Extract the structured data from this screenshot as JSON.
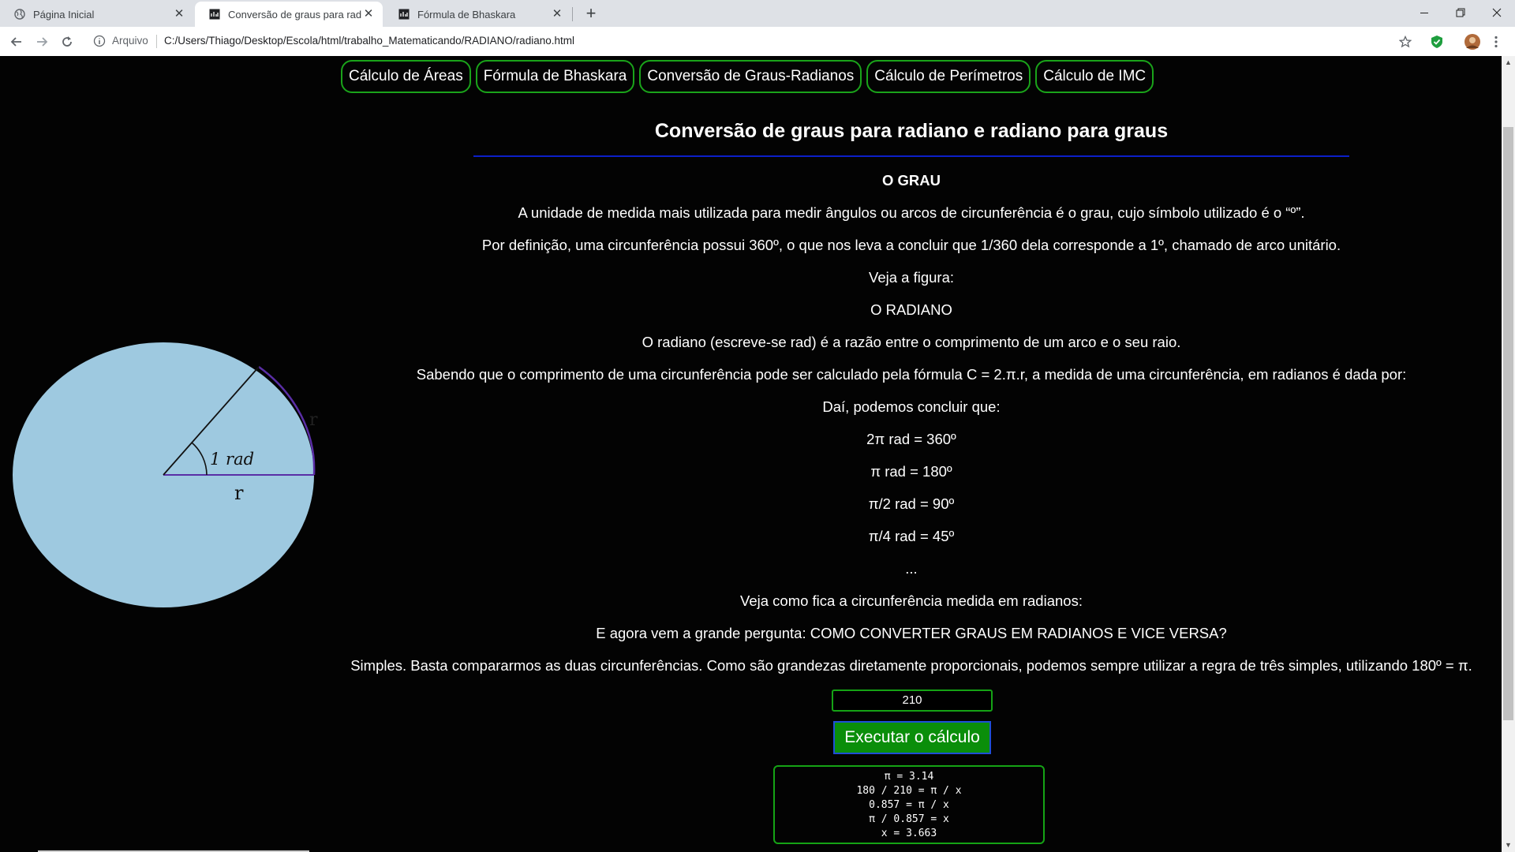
{
  "browser": {
    "tabs": [
      {
        "title": "Página Inicial"
      },
      {
        "title": "Conversão de graus para radiano"
      },
      {
        "title": "Fórmula de Bhaskara"
      }
    ],
    "address": {
      "scheme": "Arquivo",
      "url": "C:/Users/Thiago/Desktop/Escola/html/trabalho_Matematicando/RADIANO/radiano.html"
    }
  },
  "nav": {
    "items": [
      {
        "label": "Cálculo de Áreas"
      },
      {
        "label": "Fórmula de Bhaskara"
      },
      {
        "label": "Conversão de Graus-Radianos"
      },
      {
        "label": "Cálculo de Perímetros"
      },
      {
        "label": "Cálculo de IMC"
      }
    ]
  },
  "page": {
    "title": "Conversão de graus para radiano e radiano para graus",
    "section_title": "O GRAU",
    "p1": "A unidade de medida mais utilizada para medir ângulos ou arcos de circunferência é o grau, cujo símbolo utilizado é o “º”.",
    "p2": "Por definição, uma circunferência possui 360º, o que nos leva a concluir que 1/360 dela corresponde a 1º, chamado de arco unitário.",
    "p3": "Veja a figura:",
    "p4": "O RADIANO",
    "p5": "O radiano (escreve-se rad) é a razão entre o comprimento de um arco e o seu raio.",
    "p6": "Sabendo que o comprimento de uma circunferência pode ser calculado pela fórmula C = 2.π.r, a medida de uma circunferência, em radianos é dada por:",
    "p7": "Daí, podemos concluir que:",
    "eq1": "2π rad = 360º",
    "eq2": "π rad = 180º",
    "eq3": "π/2 rad = 90º",
    "eq4": "π/4 rad = 45º",
    "ellipsis": "...",
    "p8": "Veja como fica a circunferência medida em radianos:",
    "p9": "E agora vem a grande pergunta: COMO CONVERTER GRAUS EM RADIANOS E VICE VERSA?",
    "p10": "Simples. Basta compararmos as duas circunferências. Como são grandezas diretamente proporcionais, podemos sempre utilizar a regra de três simples, utilizando 180º = π."
  },
  "figure": {
    "angle_label": "1 rad",
    "radius_label": "r",
    "arc_label": "r",
    "fill_color": "#9ec9e0",
    "arc_color": "#5a2ea6"
  },
  "calculator": {
    "input_value": "210",
    "button_label": "Executar o cálculo",
    "result_lines": [
      "π = 3.14",
      "180 / 210 = π / x",
      "0.857 = π / x",
      "π / 0.857 = x",
      "x = 3.663"
    ]
  },
  "colors": {
    "accent_green": "#15a315",
    "button_green": "#0a8e0a",
    "rule_blue": "#0b1fc8",
    "page_bg": "#030303"
  }
}
